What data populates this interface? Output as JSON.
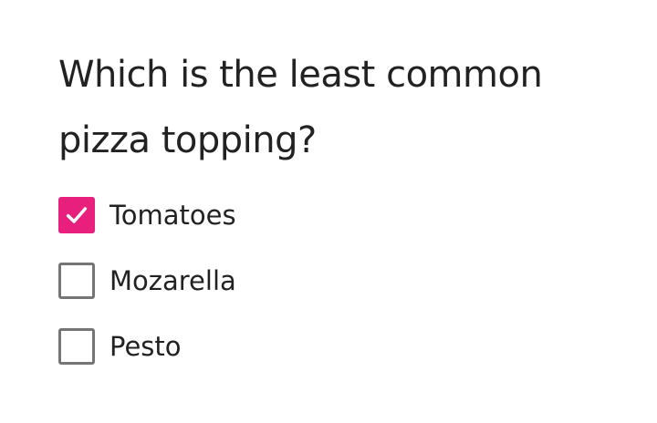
{
  "question": {
    "text": "Which is the least common pizza topping?"
  },
  "options": [
    {
      "label": "Tomatoes",
      "checked": true
    },
    {
      "label": "Mozarella",
      "checked": false
    },
    {
      "label": "Pesto",
      "checked": false
    }
  ],
  "colors": {
    "accent": "#e81f7c",
    "border": "#757575",
    "text": "#222222"
  },
  "icons": {
    "check": "check-icon"
  }
}
